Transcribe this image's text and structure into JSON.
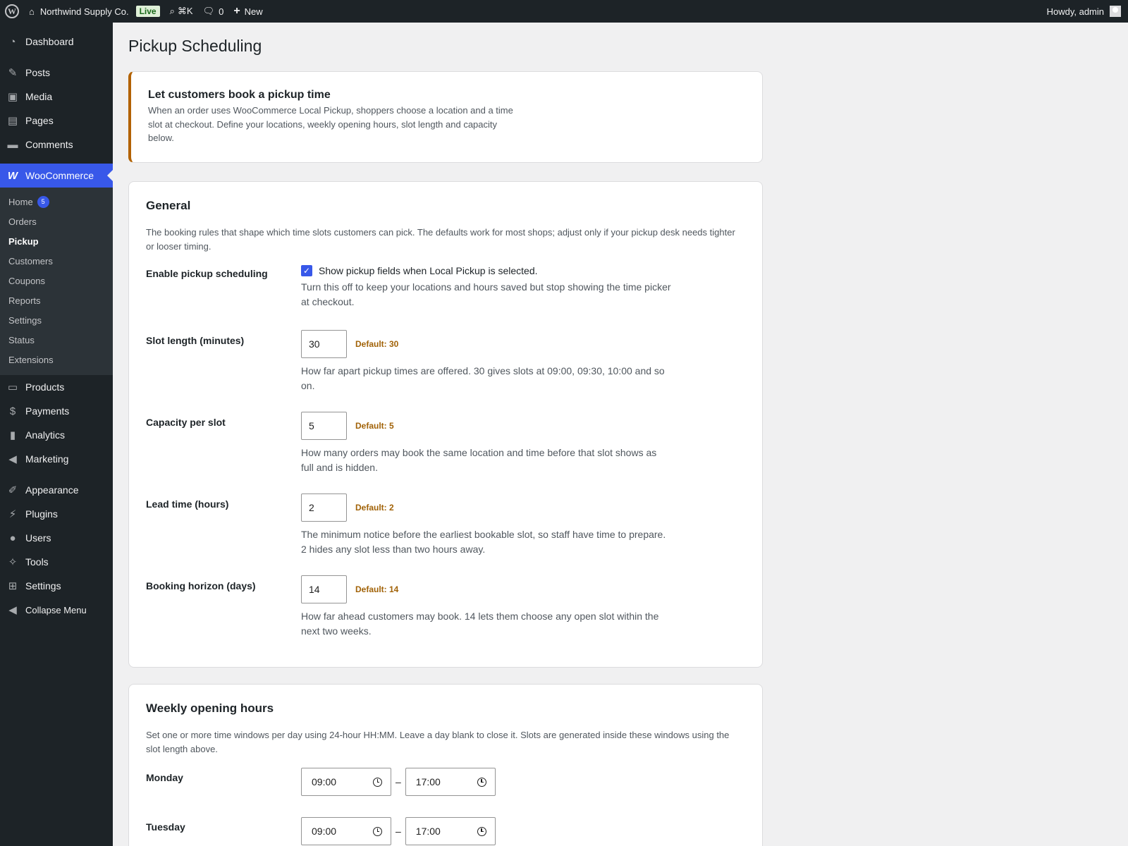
{
  "adminbar": {
    "site_name": "Northwind Supply Co.",
    "live_badge": "Live",
    "search_shortcut": "⌘K",
    "comments_count": "0",
    "new_label": "New",
    "howdy": "Howdy, admin"
  },
  "sidebar": {
    "dashboard": "Dashboard",
    "posts": "Posts",
    "media": "Media",
    "pages": "Pages",
    "comments": "Comments",
    "woocommerce": "WooCommerce",
    "woo_sub": {
      "home": "Home",
      "home_count": "5",
      "orders": "Orders",
      "pickup": "Pickup",
      "customers": "Customers",
      "coupons": "Coupons",
      "reports": "Reports",
      "settings": "Settings",
      "status": "Status",
      "extensions": "Extensions"
    },
    "products": "Products",
    "payments": "Payments",
    "analytics": "Analytics",
    "marketing": "Marketing",
    "appearance": "Appearance",
    "plugins": "Plugins",
    "users": "Users",
    "tools": "Tools",
    "settings": "Settings",
    "collapse": "Collapse Menu"
  },
  "page": {
    "title": "Pickup Scheduling"
  },
  "intro": {
    "heading": "Let customers book a pickup time",
    "text": "When an order uses WooCommerce Local Pickup, shoppers choose a location and a time slot at checkout. Define your locations, weekly opening hours, slot length and capacity below."
  },
  "general": {
    "heading": "General",
    "description": "The booking rules that shape which time slots customers can pick. The defaults work for most shops; adjust only if your pickup desk needs tighter or looser timing.",
    "enable": {
      "label": "Enable pickup scheduling",
      "checkbox_label": "Show pickup fields when Local Pickup is selected.",
      "help": "Turn this off to keep your locations and hours saved but stop showing the time picker at checkout."
    },
    "slot_length": {
      "label": "Slot length (minutes)",
      "value": "30",
      "default": "Default: 30",
      "help": "How far apart pickup times are offered. 30 gives slots at 09:00, 09:30, 10:00 and so on."
    },
    "capacity": {
      "label": "Capacity per slot",
      "value": "5",
      "default": "Default: 5",
      "help": "How many orders may book the same location and time before that slot shows as full and is hidden."
    },
    "lead_time": {
      "label": "Lead time (hours)",
      "value": "2",
      "default": "Default: 2",
      "help": "The minimum notice before the earliest bookable slot, so staff have time to prepare. 2 hides any slot less than two hours away."
    },
    "horizon": {
      "label": "Booking horizon (days)",
      "value": "14",
      "default": "Default: 14",
      "help": "How far ahead customers may book. 14 lets them choose any open slot within the next two weeks."
    }
  },
  "hours": {
    "heading": "Weekly opening hours",
    "description": "Set one or more time windows per day using 24-hour HH:MM. Leave a day blank to close it. Slots are generated inside these windows using the slot length above.",
    "separator": "–",
    "days": [
      {
        "name": "Monday",
        "open": "09:00",
        "close": "17:00"
      },
      {
        "name": "Tuesday",
        "open": "09:00",
        "close": "17:00"
      }
    ]
  }
}
